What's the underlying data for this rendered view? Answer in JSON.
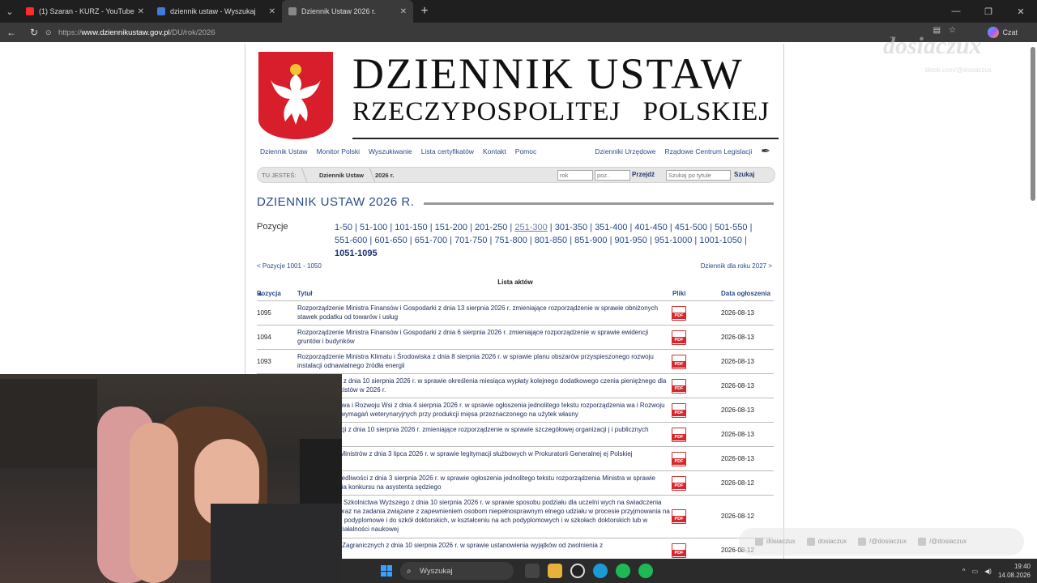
{
  "browser": {
    "tabs": [
      {
        "label": "(1) Szaran - KURZ - YouTube",
        "color": "#ff2a2a"
      },
      {
        "label": "dziennik ustaw - Wyszukaj",
        "color": "#3b7dd8"
      },
      {
        "label": "Dziennik Ustaw 2026 r.",
        "color": "#888888"
      }
    ],
    "url_prefix": "https://",
    "url_host": "www.dziennikustaw.gov.pl",
    "url_path": "/DU/rok/2026",
    "copilot_label": "Czat"
  },
  "site": {
    "title_line1": "DZIENNIK USTAW",
    "title_line2": "RZECZYPOSPOLITEJ POLSKIEJ",
    "menu_left": [
      "Dziennik Ustaw",
      "Monitor Polski",
      "Wyszukiwanie",
      "Lista certyfikatów",
      "Kontakt",
      "Pomoc"
    ],
    "menu_right": [
      "Dzienniki Urzędowe",
      "Rządowe Centrum Legislacji"
    ],
    "breadcrumb": {
      "you_are_here": "TU JESTEŚ:",
      "item1": "Dziennik Ustaw",
      "item2": "2026 r.",
      "year_placeholder": "rok",
      "pos_placeholder": "poz.",
      "go_label": "Przejdź",
      "search_placeholder": "Szukaj po tytule",
      "search_label": "Szukaj"
    },
    "section_title": "DZIENNIK USTAW 2026 R.",
    "positions_label": "Pozycje",
    "ranges": [
      "1-50",
      "51-100",
      "101-150",
      "151-200",
      "201-250",
      "251-300",
      "301-350",
      "351-400",
      "401-450",
      "451-500",
      "501-550",
      "551-600",
      "601-650",
      "651-700",
      "701-750",
      "751-800",
      "801-850",
      "851-900",
      "901-950",
      "951-1000",
      "1001-1050",
      "1051-1095"
    ],
    "current_range": "1051-1095",
    "prev_link": "< Pozycje 1001 - 1050",
    "next_link": "Dziennik dla roku 2027 >",
    "list_heading": "Lista aktów",
    "columns": {
      "position": "Pozycja",
      "title": "Tytuł",
      "files": "Pliki",
      "date": "Data ogłoszenia"
    },
    "rows": [
      {
        "poz": "1095",
        "title": "Rozporządzenie Ministra Finansów i Gospodarki z dnia 13 sierpnia 2026 r. zmieniające rozporządzenie w sprawie obniżonych stawek podatku od towarów i usług",
        "date": "2026-08-13"
      },
      {
        "poz": "1094",
        "title": "Rozporządzenie Ministra Finansów i Gospodarki z dnia 6 sierpnia 2026 r. zmieniające rozporządzenie w sprawie ewidencji gruntów i budynków",
        "date": "2026-08-13"
      },
      {
        "poz": "1093",
        "title": "Rozporządzenie Ministra Klimatu i Środowiska z dnia 8 sierpnia 2026 r. w sprawie planu obszarów przyspieszonego rozwoju instalacji odnawialnego źródła energii",
        "date": "2026-08-13"
      },
      {
        "poz": "",
        "title": "Rady Ministrów z dnia 10 sierpnia 2026 r. w sprawie określenia miesiąca wypłaty kolejnego dodatkowego czenia pieniężnego dla emerytów i rencistów w 2026 r.",
        "date": "2026-08-13"
      },
      {
        "poz": "",
        "title": "Ministra Rolnictwa i Rozwoju Wsi z dnia 4 sierpnia 2026 r. w sprawie ogłoszenia jednolitego tekstu rozporządzenia wa i Rozwoju Wsi w sprawie wymagań weterynaryjnych przy produkcji mięsa przeznaczonego na użytek własny",
        "date": "2026-08-13"
      },
      {
        "poz": "",
        "title": "Ministra Edukacji z dnia 10 sierpnia 2026 r. zmieniające rozporządzenie w sprawie szczegółowej organizacji j i publicznych przedszkoli",
        "date": "2026-08-13"
      },
      {
        "poz": "",
        "title": "Prezesa Rady Ministrów z dnia 3 lipca 2026 r. w sprawie legitymacji służbowych w Prokuratorii Generalnej ej Polskiej",
        "date": "2026-08-13"
      },
      {
        "poz": "",
        "title": "Ministra Sprawiedliwości z dnia 3 sierpnia 2026 r. w sprawie ogłoszenia jednolitego tekstu rozporządzenia Ministra w sprawie przeprowadzania konkursu na asystenta sędziego",
        "date": "2026-08-12"
      },
      {
        "poz": "",
        "title": "Ministra Nauki i Szkolnictwa Wyższego z dnia 10 sierpnia 2026 r. w sprawie sposobu podziału dla uczelni wych na świadczenia dla studentów oraz na zadania związane z zapewnieniem osobom niepełnosprawnym elnego udziału w procesie przyjmowania na studia, studiach podyplomowe i do szkół doktorskich, w kształceniu na ach podyplomowych i w szkołach doktorskich lub w prowadzeniu działalności naukowej",
        "date": "2026-08-12",
        "tall": true
      },
      {
        "poz": "",
        "title": "Ministra Spraw Zagranicznych z dnia 10 sierpnia 2026 r. w sprawie ustanowienia wyjątków od zwolnienia z",
        "date": "2026-08-12"
      }
    ]
  },
  "overlay": {
    "watermark": "dosiaczux",
    "watermark_sub": "tiktok.com/@dosiaczux",
    "socials": [
      "dosiaczux",
      "dosiaczux",
      "/@dosiaczux",
      "/@dosiaczux"
    ]
  },
  "taskbar": {
    "search_label": "Wyszukaj",
    "time": "19:40",
    "date": "14.08.2026"
  },
  "colors": {
    "link": "#2a4a8a",
    "pdf_red": "#d8262c",
    "eagle_red": "#d81e2a"
  }
}
